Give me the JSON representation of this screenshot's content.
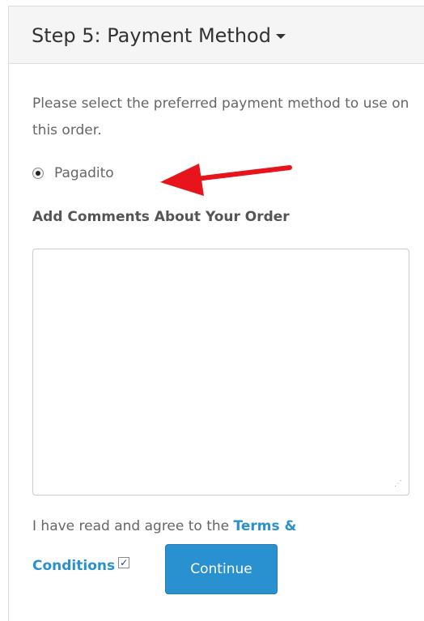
{
  "panel": {
    "title": "Step 5: Payment Method"
  },
  "payment": {
    "intro_text": "Please select the preferred payment method to use on this order.",
    "option_label": "Pagadito",
    "option_selected": true
  },
  "comments": {
    "label": "Add Comments About Your Order",
    "value": ""
  },
  "agreement": {
    "text": "I have read and agree to the ",
    "terms_link_part1": "Terms &",
    "terms_link_part2": "Conditions",
    "checked": true
  },
  "actions": {
    "continue_label": "Continue"
  },
  "colors": {
    "accent": "#2a91d1",
    "arrow": "#e8141b",
    "heading_bg": "#f5f5f5"
  },
  "icons": {
    "caret": "caret-down-icon",
    "arrow": "red-arrow-annotation",
    "checkmark": "checkmark-icon",
    "resize": "resize-grip-icon"
  }
}
